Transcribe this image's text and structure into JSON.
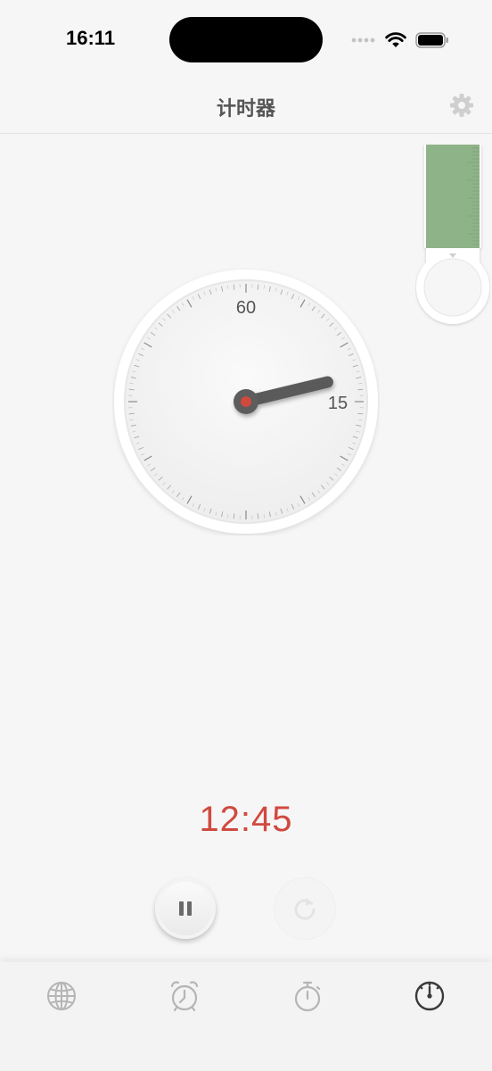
{
  "status_bar": {
    "time": "16:11",
    "icons": [
      "signal-icon",
      "wifi-icon",
      "battery-icon"
    ]
  },
  "nav": {
    "title": "计时器",
    "settings_icon": "gear-icon"
  },
  "dial": {
    "labels": {
      "top": "60",
      "right": "15"
    },
    "hand_minutes": 12.75,
    "hub_color": "#d0493f"
  },
  "timer": {
    "readout": "12:45",
    "readout_color": "#d0493f",
    "state": "running"
  },
  "controls": {
    "pause_icon": "pause-icon",
    "reset_icon": "reset-icon"
  },
  "tabs": [
    {
      "name": "world-clock",
      "icon": "globe-icon",
      "selected": false
    },
    {
      "name": "alarm",
      "icon": "alarm-clock-icon",
      "selected": false
    },
    {
      "name": "stopwatch",
      "icon": "stopwatch-icon",
      "selected": false
    },
    {
      "name": "timer",
      "icon": "timer-icon",
      "selected": true
    }
  ],
  "colors": {
    "accent": "#d0493f",
    "ruler_green": "#8fb389",
    "background": "#f6f6f6"
  }
}
